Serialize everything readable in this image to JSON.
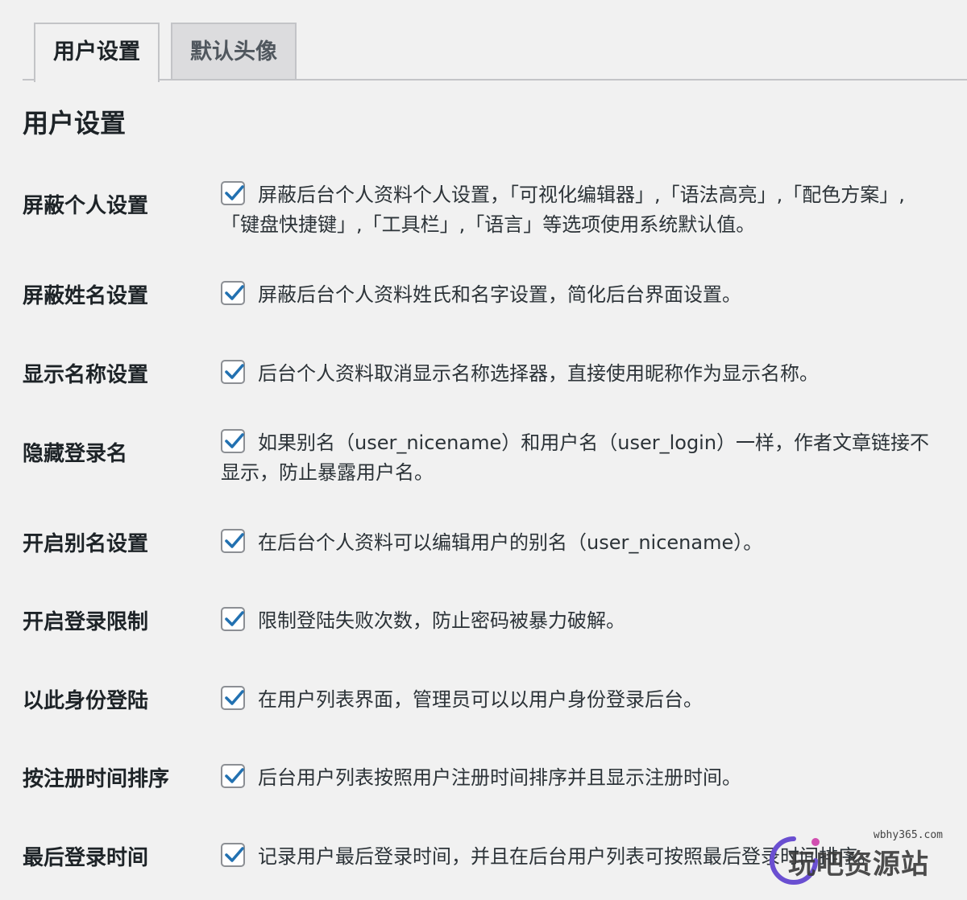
{
  "tabs": [
    {
      "label": "用户设置",
      "active": true
    },
    {
      "label": "默认头像",
      "active": false
    }
  ],
  "section_title": "用户设置",
  "settings": [
    {
      "label": "屏蔽个人设置",
      "checked": true,
      "description": "屏蔽后台个人资料个人设置，「可视化编辑器」,「语法高亮」,「配色方案」,「键盘快捷键」,「工具栏」,「语言」等选项使用系统默认值。"
    },
    {
      "label": "屏蔽姓名设置",
      "checked": true,
      "description": "屏蔽后台个人资料姓氏和名字设置，简化后台界面设置。"
    },
    {
      "label": "显示名称设置",
      "checked": true,
      "description": "后台个人资料取消显示名称选择器，直接使用昵称作为显示名称。"
    },
    {
      "label": "隐藏登录名",
      "checked": true,
      "description": "如果别名（user_nicename）和用户名（user_login）一样，作者文章链接不显示，防止暴露用户名。"
    },
    {
      "label": "开启别名设置",
      "checked": true,
      "description": "在后台个人资料可以编辑用户的别名（user_nicename）。"
    },
    {
      "label": "开启登录限制",
      "checked": true,
      "description": "限制登陆失败次数，防止密码被暴力破解。"
    },
    {
      "label": "以此身份登陆",
      "checked": true,
      "description": "在用户列表界面，管理员可以以用户身份登录后台。"
    },
    {
      "label": "按注册时间排序",
      "checked": true,
      "description": "后台用户列表按照用户注册时间排序并且显示注册时间。"
    },
    {
      "label": "最后登录时间",
      "checked": true,
      "description": "记录用户最后登录时间，并且在后台用户列表可按照最后登录时间排序。"
    }
  ],
  "watermark": {
    "url": "wbhy365.com",
    "text": "玩吧资源站"
  },
  "colors": {
    "checkmark": "#2271b1",
    "background": "#f1f1f1",
    "inactive_tab": "#dcdcde",
    "border": "#c3c4c7"
  }
}
